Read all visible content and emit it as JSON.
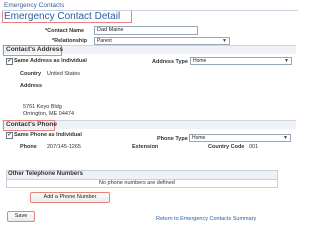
{
  "breadcrumb": "Emergency Contacts",
  "page_title": "Emergency Contact Detail",
  "contact_name": {
    "label": "*Contact Name",
    "value": "Dad Maine"
  },
  "relationship": {
    "label": "*Relationship",
    "value": "Parent"
  },
  "address_section": {
    "title": "Contact's Address",
    "same_as_individual_label": "Same Address as Individual",
    "same_as_individual_checked": true,
    "country_label": "Country",
    "country_value": "United States",
    "address_type_label": "Address Type",
    "address_type_value": "Home",
    "address_label": "Address",
    "address_line1": "5761 Keyo Bldg",
    "address_line2": "Orrington, ME 04474"
  },
  "phone_section": {
    "title": "Contact's Phone",
    "same_phone_label": "Same Phone as Individual",
    "same_phone_checked": true,
    "phone_type_label": "Phone Type",
    "phone_type_value": "Home",
    "phone_label": "Phone",
    "phone_value": "207/145-1265",
    "extension_label": "Extension",
    "country_code_label": "Country Code",
    "country_code_value": "001"
  },
  "other_phones": {
    "title": "Other Telephone Numbers",
    "empty_message": "No phone numbers are defined"
  },
  "add_phone_button": "Add a Phone Number",
  "save_button": "Save",
  "return_link": "Return to Emergency Contacts Summary",
  "colors": {
    "accent": "#2a5ea0",
    "highlight": "#e6837a"
  }
}
